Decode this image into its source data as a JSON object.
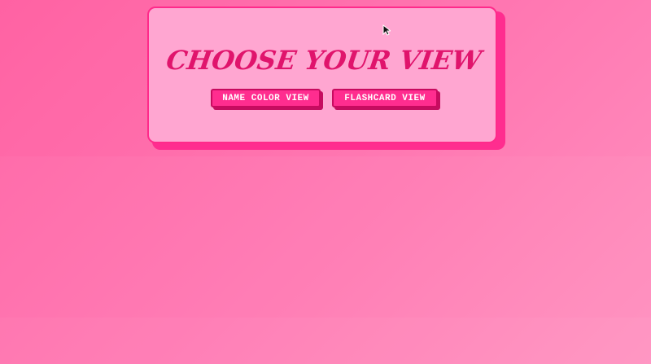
{
  "page": {
    "title": "CHOOSE YOUR VIEW"
  },
  "view_buttons": [
    {
      "label": "NAME COLOR VIEW"
    },
    {
      "label": "FLASHCARD VIEW"
    }
  ],
  "icons": {
    "cursor": "mouse-pointer-icon"
  },
  "colors": {
    "background": "#ff74b0",
    "panel": "#ffa6d1",
    "accent": "#ff2d8f",
    "title": "#e0146c",
    "button_text": "#ffffff"
  }
}
